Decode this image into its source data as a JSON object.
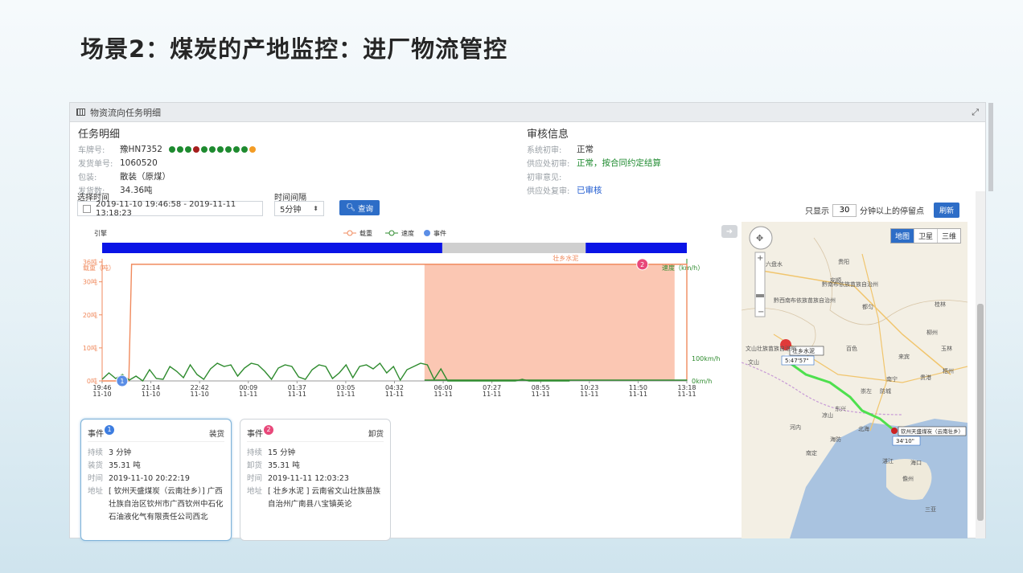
{
  "slide_title": "场景2：煤炭的产地监控：进厂物流管控",
  "panel": {
    "title": "物资流向任务明细"
  },
  "task": {
    "header": "任务明细",
    "rows": [
      {
        "label": "车牌号:",
        "value": "豫HN7352"
      },
      {
        "label": "发货单号:",
        "value": "1060520"
      },
      {
        "label": "包装:",
        "value": "散装（原煤）"
      },
      {
        "label": "发货数:",
        "value": "34.36吨"
      }
    ],
    "dot_colors": [
      "#1e8a2f",
      "#1e8a2f",
      "#1e8a2f",
      "#a51d1d",
      "#1e8a2f",
      "#1e8a2f",
      "#1e8a2f",
      "#1e8a2f",
      "#1e8a2f",
      "#1e8a2f",
      "#f39c25"
    ]
  },
  "audit": {
    "header": "审核信息",
    "rows": [
      {
        "label": "系统初审:",
        "value": "正常"
      },
      {
        "label": "供应处初审:",
        "value": "正常，按合同约定结算"
      },
      {
        "label": "初审意见:",
        "value": ""
      },
      {
        "label": "供应处复审:",
        "value": "已审核"
      }
    ]
  },
  "controls": {
    "time_label": "选择时间",
    "time_range": "2019-11-10 19:46:58 - 2019-11-11 13:18:23",
    "interval_label": "时间间隔",
    "interval_value": "5分钟",
    "query_label": "查询",
    "stop_prefix": "只显示",
    "stop_value": "30",
    "stop_suffix": "分钟以上的停留点",
    "refresh_label": "刷新"
  },
  "chart_data": {
    "type": "line",
    "legend": [
      "载重",
      "速度",
      "事件"
    ],
    "engine_label": "引擎",
    "y_left_label": "载重（吨）",
    "y_right_label": "速度（km/h）",
    "y_left_ticks": [
      "36吨",
      "30吨",
      "20吨",
      "10吨",
      "0吨"
    ],
    "y_left_tick_values": [
      36,
      30,
      20,
      10,
      0
    ],
    "y_right_ticks": [
      "100km/h",
      "0km/h"
    ],
    "x_ticks": [
      [
        "19:46",
        "11-10"
      ],
      [
        "21:14",
        "11-10"
      ],
      [
        "22:42",
        "11-10"
      ],
      [
        "00:09",
        "11-11"
      ],
      [
        "01:37",
        "11-11"
      ],
      [
        "03:05",
        "11-11"
      ],
      [
        "04:32",
        "11-11"
      ],
      [
        "06:00",
        "11-11"
      ],
      [
        "07:27",
        "11-11"
      ],
      [
        "08:55",
        "11-11"
      ],
      [
        "10:23",
        "11-11"
      ],
      [
        "11:50",
        "11-11"
      ],
      [
        "13:18",
        "11-11"
      ]
    ],
    "time_start_min": 0,
    "time_end_min": 1052,
    "load_series": {
      "name": "载重",
      "x_min": [
        0,
        48,
        53,
        1185,
        1240,
        1300
      ],
      "values": [
        0,
        0,
        35.3,
        35.3,
        0.4,
        0.4
      ]
    },
    "engine_bar": [
      {
        "start_min": 0,
        "end_min": 612,
        "state": "on"
      },
      {
        "start_min": 612,
        "end_min": 870,
        "state": "off"
      },
      {
        "start_min": 870,
        "end_min": 1052,
        "state": "on"
      }
    ],
    "zone": {
      "label": "壮乡水泥",
      "start_min": 580,
      "end_min": 1030
    },
    "events": [
      {
        "id": "1",
        "x_min": 36,
        "load": 0
      },
      {
        "id": "2",
        "x_min": 972,
        "load": 35.3
      }
    ],
    "speed_profile": [
      2,
      10,
      3,
      8,
      1,
      6,
      0,
      14,
      3,
      2,
      18,
      12,
      4,
      20,
      8,
      2,
      15,
      22,
      18,
      20,
      6,
      16,
      22,
      20,
      12,
      2,
      16,
      20,
      18,
      5,
      2,
      14,
      20,
      18,
      3,
      10,
      20,
      4,
      18,
      20,
      15,
      22,
      10,
      18,
      1,
      14,
      18,
      22,
      20,
      2,
      15,
      0,
      0,
      0,
      0,
      0,
      0,
      0,
      0,
      0,
      0,
      0,
      2,
      0,
      0,
      0,
      0,
      0,
      0,
      0
    ],
    "colors": {
      "load": "#f08a5d",
      "speed": "#2e8b2e",
      "event": "#5b8ee6",
      "engine_on": "#0a14e6",
      "engine_off": "#cfcfcf",
      "zone": "#fbc7b3"
    }
  },
  "events": [
    {
      "title": "事件",
      "badge": "1",
      "kind": "装货",
      "badge_color": "#3d7de0",
      "rows": [
        {
          "k": "持续",
          "v": "3 分钟"
        },
        {
          "k": "装货",
          "v": "35.31 吨"
        },
        {
          "k": "时间",
          "v": "2019-11-10 20:22:19"
        },
        {
          "k": "地址",
          "v": "[ 钦州天盛煤炭（云南壮乡）] 广西壮族自治区钦州市广西钦州中石化石油液化气有限责任公司西北"
        }
      ]
    },
    {
      "title": "事件",
      "badge": "2",
      "kind": "卸货",
      "badge_color": "#e8487a",
      "rows": [
        {
          "k": "持续",
          "v": "15 分钟"
        },
        {
          "k": "卸货",
          "v": "35.31 吨"
        },
        {
          "k": "时间",
          "v": "2019-11-11 12:03:23"
        },
        {
          "k": "地址",
          "v": "[ 壮乡水泥 ] 云南省文山壮族苗族自治州广南县八宝镇英论"
        }
      ]
    }
  ],
  "map": {
    "tabs": [
      "地图",
      "卫星",
      "三维"
    ],
    "start_label": "钦州天盛煤炭（云南壮乡）",
    "start_time": "34'10\"",
    "end_label": "壮乡水泥",
    "end_time": "5:47'57\"",
    "places": [
      "六盘水",
      "贵阳",
      "安顺",
      "黔南布依族苗族自治州",
      "黔西南布依族苗族自治州",
      "都匀",
      "桂林",
      "柳州",
      "文山壮族苗族自治州",
      "百色",
      "文山",
      "来宾",
      "南宁",
      "贵港",
      "梧州",
      "玉林",
      "崇左",
      "凉山",
      "北海",
      "河内",
      "海防",
      "防城",
      "南定",
      "湛江",
      "海口",
      "儋州",
      "三亚",
      "东兴"
    ]
  }
}
